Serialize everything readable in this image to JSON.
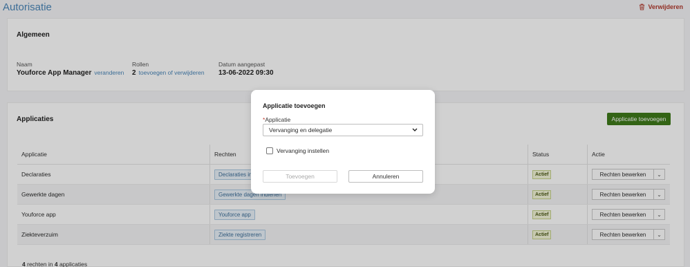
{
  "header": {
    "title": "Autorisatie",
    "delete_label": "Verwijderen"
  },
  "general": {
    "title": "Algemeen",
    "name_label": "Naam",
    "name_value": "Youforce App Manager",
    "name_link": "veranderen",
    "roles_label": "Rollen",
    "roles_value": "2",
    "roles_link": "toevoegen of verwijderen",
    "date_label": "Datum aangepast",
    "date_value": "13-06-2022 09:30"
  },
  "apps": {
    "title": "Applicaties",
    "add_button": "Applicatie toevoegen",
    "columns": [
      "Applicatie",
      "Rechten",
      "Status",
      "Actie"
    ],
    "rows": [
      {
        "app": "Declaraties",
        "right": "Declaraties indienen",
        "status": "Actief",
        "action": "Rechten bewerken"
      },
      {
        "app": "Gewerkte dagen",
        "right": "Gewerkte dagen indienen",
        "status": "Actief",
        "action": "Rechten bewerken"
      },
      {
        "app": "Youforce app",
        "right": "Youforce app",
        "status": "Actief",
        "action": "Rechten bewerken"
      },
      {
        "app": "Ziekteverzuim",
        "right": "Ziekte registreren",
        "status": "Actief",
        "action": "Rechten bewerken"
      }
    ],
    "footer": {
      "rights_count": "4",
      "rights_text": "rechten in",
      "apps_count": "4",
      "apps_text": "applicaties"
    }
  },
  "modal": {
    "title": "Applicatie toevoegen",
    "required_mark": "*",
    "field_label": "Applicatie",
    "select_value": "Vervanging en delegatie",
    "checkbox_label": "Vervanging instellen",
    "checkbox_checked": false,
    "add_button": "Toevoegen",
    "cancel_button": "Annuleren"
  },
  "colors": {
    "accent_blue": "#4a86b8",
    "primary_green": "#3f7a1a",
    "danger_red": "#b23a2e"
  }
}
